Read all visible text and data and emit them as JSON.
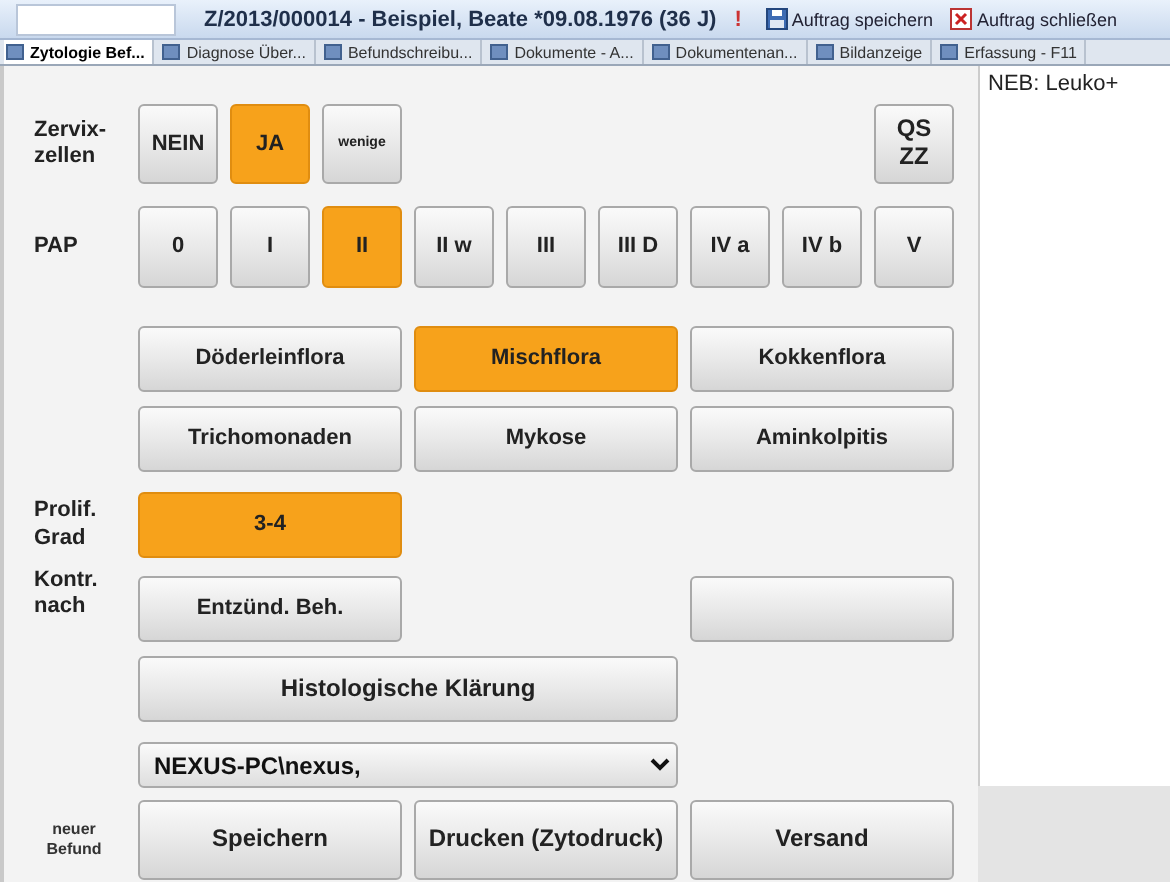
{
  "title_bar": {
    "title": "Z/2013/000014 - Beispiel, Beate *09.08.1976 (36 J)",
    "flag": "!",
    "actions": [
      {
        "kind": "save",
        "label": "Auftrag speichern"
      },
      {
        "kind": "close",
        "label": "Auftrag schließen"
      }
    ]
  },
  "tabs": [
    {
      "label": "Zytologie Bef...",
      "selected": true
    },
    {
      "label": "Diagnose Über...",
      "selected": false
    },
    {
      "label": "Befundschreibu...",
      "selected": false
    },
    {
      "label": "Dokumente - A...",
      "selected": false
    },
    {
      "label": "Dokumentenan...",
      "selected": false
    },
    {
      "label": "Bildanzeige",
      "selected": false
    },
    {
      "label": "Erfassung - F11",
      "selected": false
    }
  ],
  "zervixzellen": {
    "label": "Zervix-zellen",
    "options": [
      {
        "label": "NEIN",
        "selected": false
      },
      {
        "label": "JA",
        "selected": true
      },
      {
        "label": "wenige",
        "selected": false
      }
    ],
    "qs_button": "QS ZZ"
  },
  "pap": {
    "label": "PAP",
    "options": [
      {
        "label": "0",
        "selected": false
      },
      {
        "label": "I",
        "selected": false
      },
      {
        "label": "II",
        "selected": true
      },
      {
        "label": "II w",
        "selected": false
      },
      {
        "label": "III",
        "selected": false
      },
      {
        "label": "III D",
        "selected": false
      },
      {
        "label": "IV a",
        "selected": false
      },
      {
        "label": "IV b",
        "selected": false
      },
      {
        "label": "V",
        "selected": false
      }
    ]
  },
  "flora": {
    "options": [
      {
        "label": "Döderleinflora",
        "selected": false
      },
      {
        "label": "Mischflora",
        "selected": true
      },
      {
        "label": "Kokkenflora",
        "selected": false
      },
      {
        "label": "Trichomonaden",
        "selected": false
      },
      {
        "label": "Mykose",
        "selected": false
      },
      {
        "label": "Aminkolpitis",
        "selected": false
      }
    ]
  },
  "proliferation": {
    "label": "Prolif. Grad",
    "options": [
      {
        "label": "3-4",
        "selected": true
      }
    ]
  },
  "kontrolle": {
    "label": "Kontr. nach",
    "options": [
      {
        "label": "Entzünd. Beh.",
        "selected": false
      }
    ]
  },
  "histology": {
    "label": "Histologische Klärung",
    "selected": false
  },
  "user_dropdown": {
    "value": "NEXUS-PC\\nexus,"
  },
  "footer": {
    "label": "neuer Befund",
    "buttons": [
      "Speichern",
      "Drucken (Zytodruck)",
      "Versand"
    ]
  },
  "note": {
    "text": "NEB: Leuko+"
  }
}
